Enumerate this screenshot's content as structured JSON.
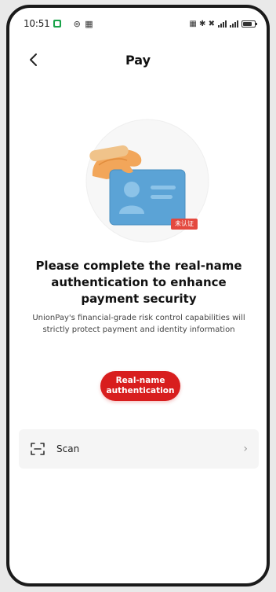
{
  "status_bar": {
    "time": "10:51",
    "extra_icons": "⊚ ▦",
    "right_icons": "▦ ✱ ✖"
  },
  "header": {
    "title": "Pay"
  },
  "illustration": {
    "badge_text": "未认证"
  },
  "main": {
    "heading": "Please complete the real-name authentication to enhance payment security",
    "subtext": "UnionPay's financial-grade risk control capabilities will strictly protect payment and identity information",
    "auth_button_label": "Real-name authentication"
  },
  "scan_row": {
    "label": "Scan"
  },
  "colors": {
    "accent": "#d81e1e",
    "card_blue": "#5ba3d6",
    "hand_orange": "#f2a65a"
  }
}
